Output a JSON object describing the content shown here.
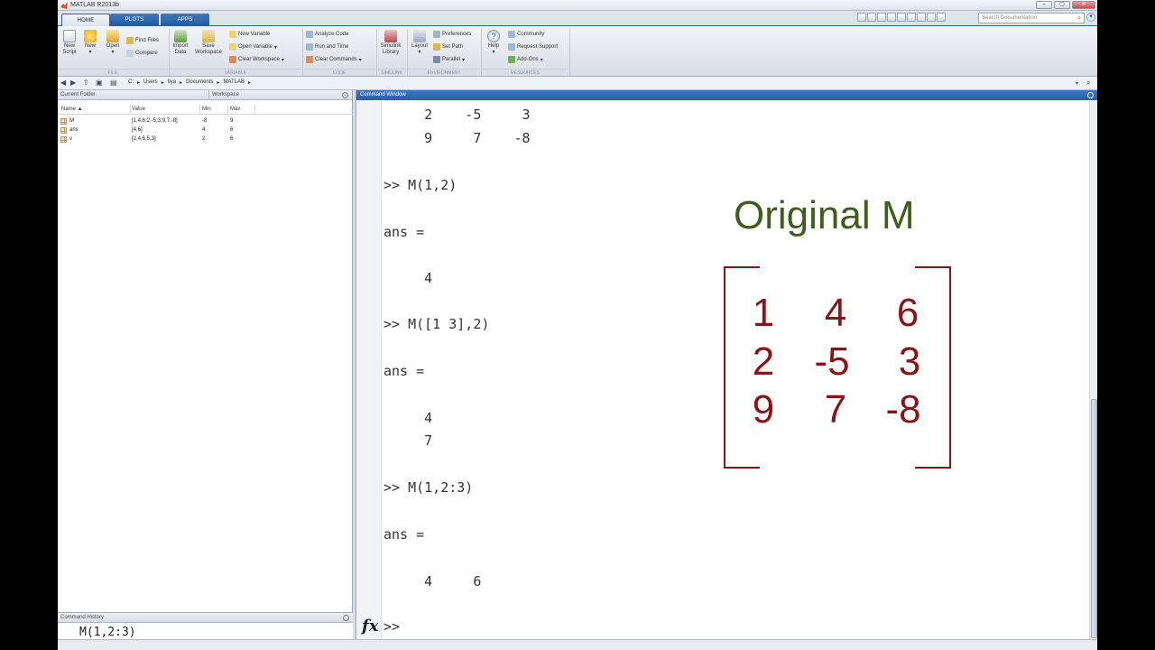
{
  "window": {
    "title": "MATLAB R2013b"
  },
  "tabs": [
    "HOME",
    "PLOTS",
    "APPS"
  ],
  "search": {
    "placeholder": "Search Documentation"
  },
  "ribbon": {
    "new_script": "New\nScript",
    "new": "New",
    "open": "Open",
    "find_files": "Find Files",
    "compare": "Compare",
    "import_data": "Import\nData",
    "save_workspace": "Save\nWorkspace",
    "new_variable": "New Variable",
    "open_variable": "Open Variable",
    "clear_workspace": "Clear Workspace",
    "analyze_code": "Analyze Code",
    "run_and_time": "Run and Time",
    "clear_commands": "Clear Commands",
    "simulink_library": "Simulink\nLibrary",
    "layout": "Layout",
    "preferences": "Preferences",
    "set_path": "Set Path",
    "parallel": "Parallel",
    "help": "Help",
    "community": "Community",
    "request_support": "Request Support",
    "add_ons": "Add-Ons",
    "groups": [
      "FILE",
      "VARIABLE",
      "CODE",
      "SIMULINK",
      "ENVIRONMENT",
      "RESOURCES"
    ]
  },
  "address": {
    "crumbs": [
      "C:",
      "Users",
      "Ilya",
      "Documents",
      "MATLAB"
    ]
  },
  "panels": {
    "current_folder": "Current Folder",
    "workspace": "Workspace",
    "command_window": "Command Window",
    "command_history": "Command History"
  },
  "workspace": {
    "columns": [
      "Name ▲",
      "Value",
      "Min",
      "Max"
    ],
    "rows": [
      {
        "name": "M",
        "value": "[1,4,6;2,-5,3;9,7,-8]",
        "min": "-8",
        "max": "9"
      },
      {
        "name": "ans",
        "value": "[4,6]",
        "min": "4",
        "max": "6"
      },
      {
        "name": "v",
        "value": "[2,4,6,5,3]",
        "min": "2",
        "max": "6"
      }
    ]
  },
  "history": {
    "last": "M(1,2:3)"
  },
  "command_lines": [
    "     2    -5     3",
    "     9     7    -8",
    ">> M(1,2)",
    "ans =",
    "     4",
    ">> M([1 3],2)",
    "ans =",
    "     4",
    "     7",
    ">> M(1,2:3)",
    "ans =",
    "     4     6",
    ">>"
  ],
  "overlay": {
    "title": "Original M",
    "matrix": [
      [
        "1",
        "4",
        "6"
      ],
      [
        "2",
        "-5",
        "3"
      ],
      [
        "9",
        "7",
        "-8"
      ]
    ]
  },
  "colors": {
    "overlay_title": "#3f5e1e",
    "overlay_matrix": "#8b1414",
    "tab_blue": "#2d5fa1"
  }
}
